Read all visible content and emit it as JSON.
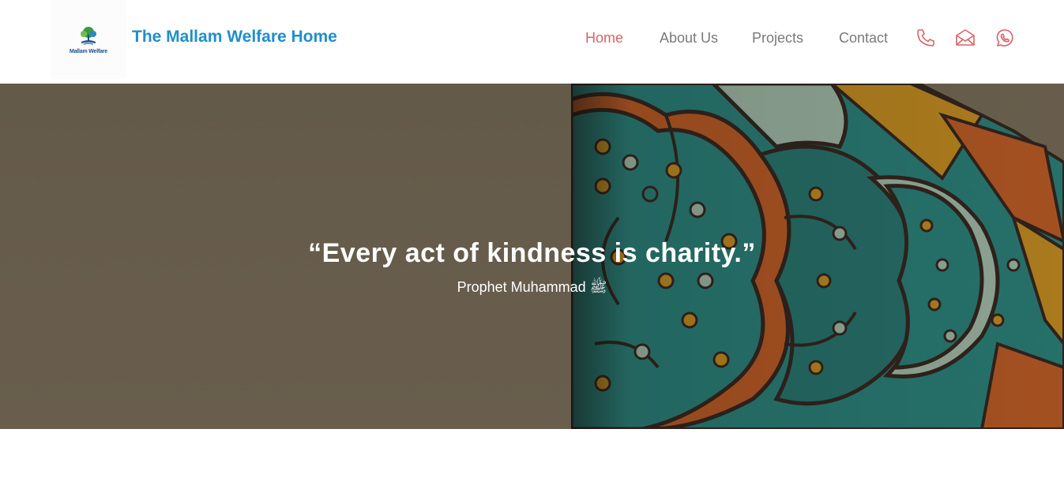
{
  "header": {
    "logo_icon": "tree-logo-icon",
    "logo_text": "Mallam Welfare",
    "brand_title": "The Mallam Welfare Home",
    "brand_color": "#1f8fcc"
  },
  "nav": {
    "items": [
      {
        "label": "Home",
        "active": true
      },
      {
        "label": "About Us",
        "active": false
      },
      {
        "label": "Projects",
        "active": false
      },
      {
        "label": "Contact",
        "active": false
      }
    ],
    "active_color": "#d9636a",
    "link_color": "#7a7a7a"
  },
  "contact_icons": [
    "phone-icon",
    "mail-icon",
    "whatsapp-icon"
  ],
  "hero": {
    "quote": "“Every act of kindness is charity.”",
    "author": "Prophet  Muhammad ﷺ",
    "background_color": "#6f6553",
    "art": "mandala-pattern"
  }
}
